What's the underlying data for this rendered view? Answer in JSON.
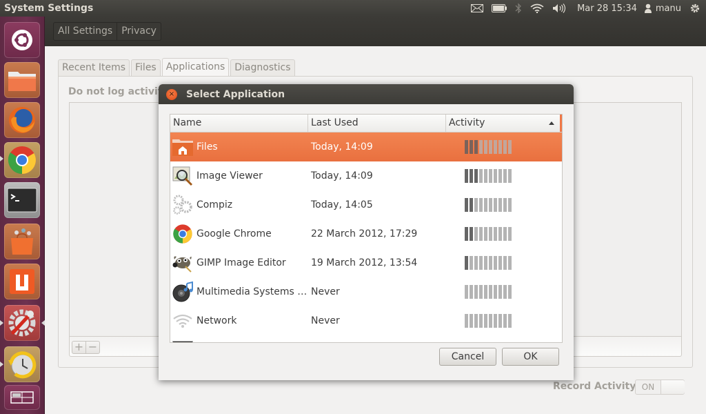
{
  "panel": {
    "app_title": "System Settings",
    "indicators": {
      "mail": "mail-icon",
      "battery": "battery-icon",
      "bluetooth": "bluetooth-icon",
      "network": "wifi-icon",
      "sound": "volume-icon"
    },
    "clock": "Mar 28 15:34",
    "user": "manu",
    "session": "power-gear-icon"
  },
  "launcher": {
    "items": [
      {
        "name": "Dash Home",
        "icon": "ubuntu-logo-icon"
      },
      {
        "name": "Files",
        "icon": "folder-icon"
      },
      {
        "name": "Firefox",
        "icon": "firefox-icon"
      },
      {
        "name": "Google Chrome",
        "icon": "chrome-icon",
        "running": true
      },
      {
        "name": "Terminal",
        "icon": "terminal-icon"
      },
      {
        "name": "Ubuntu Software Center",
        "icon": "shopping-bag-icon"
      },
      {
        "name": "Ubuntu One",
        "icon": "ubuntu-one-icon"
      },
      {
        "name": "System Settings",
        "icon": "settings-wrench-icon",
        "running": true,
        "focused": true
      },
      {
        "name": "Backup",
        "icon": "backup-clock-icon",
        "running": true
      },
      {
        "name": "Workspace Switcher",
        "icon": "workspace-switcher-icon"
      }
    ]
  },
  "toolbar": {
    "breadcrumb": [
      "All Settings",
      "Privacy"
    ]
  },
  "privacy": {
    "tabs": [
      {
        "label": "Recent Items",
        "active": false
      },
      {
        "label": "Files",
        "active": false
      },
      {
        "label": "Applications",
        "active": true
      },
      {
        "label": "Diagnostics",
        "active": false
      }
    ],
    "do_not_log_label": "Do not log activity and files used by:",
    "add_button": "+",
    "remove_button": "−",
    "record_activity_label": "Record Activity",
    "record_activity_toggle": "ON"
  },
  "dialog": {
    "title": "Select Application",
    "close_icon": "×",
    "columns": [
      "Name",
      "Last Used",
      "Activity"
    ],
    "sort_column": "Activity",
    "sort_direction": "ascending",
    "activity_scale_max": 10,
    "rows": [
      {
        "name": "Files",
        "last_used": "Today, 14:09",
        "activity": 3,
        "icon": "files-home-folder-icon",
        "selected": true
      },
      {
        "name": "Image Viewer",
        "last_used": "Today, 14:09",
        "activity": 3,
        "icon": "image-viewer-icon",
        "selected": false
      },
      {
        "name": "Compiz",
        "last_used": "Today, 14:05",
        "activity": 2,
        "icon": "gears-icon",
        "selected": false
      },
      {
        "name": "Google Chrome",
        "last_used": "22 March 2012, 17:29",
        "activity": 2,
        "icon": "chrome-icon",
        "selected": false
      },
      {
        "name": "GIMP Image Editor",
        "last_used": "19 March 2012, 13:54",
        "activity": 1,
        "icon": "gimp-icon",
        "selected": false
      },
      {
        "name": "Multimedia Systems …",
        "last_used": "Never",
        "activity": 0,
        "icon": "multimedia-speaker-icon",
        "selected": false
      },
      {
        "name": "Network",
        "last_used": "Never",
        "activity": 0,
        "icon": "network-wifi-icon",
        "selected": false
      }
    ],
    "cancel_label": "Cancel",
    "ok_label": "OK"
  }
}
